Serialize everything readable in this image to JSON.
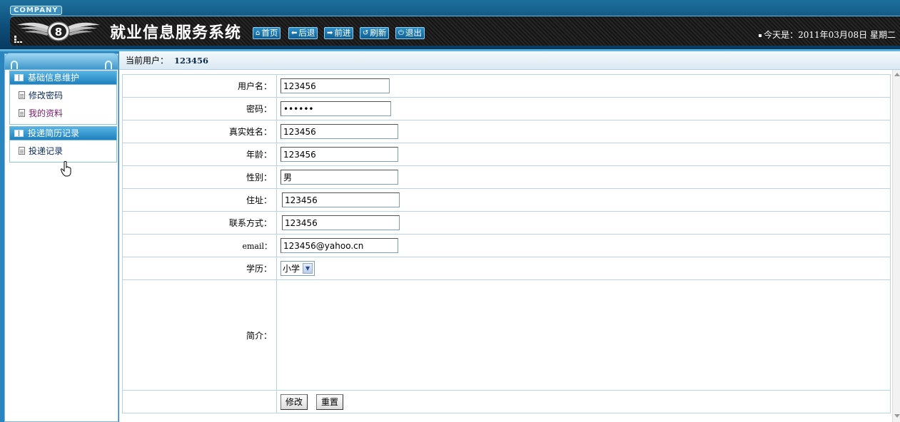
{
  "header": {
    "company_badge": "COMPANY",
    "logo": "winged-b-logo",
    "title": "就业信息服务系统",
    "nav": [
      {
        "icon": "home-icon",
        "glyph": "⌂",
        "label": "首页"
      },
      {
        "icon": "arrow-left-icon",
        "glyph": "⬅",
        "label": "后退"
      },
      {
        "icon": "arrow-right-icon",
        "glyph": "➡",
        "label": "前进"
      },
      {
        "icon": "refresh-icon",
        "glyph": "↺",
        "label": "刷新"
      },
      {
        "icon": "power-icon",
        "glyph": "⏻",
        "label": "退出"
      }
    ],
    "date_text": "今天是：2011年03月08日  星期二"
  },
  "sidebar": {
    "groups": [
      {
        "title": "基础信息维护",
        "items": [
          "修改密码",
          "我的资料"
        ]
      },
      {
        "title": "投递简历记录",
        "items": [
          "投递记录"
        ]
      }
    ]
  },
  "breadcrumb": {
    "label": "当前用户：",
    "user": "123456"
  },
  "form": {
    "username": {
      "label": "用户名：",
      "value": "123456"
    },
    "password": {
      "label": "密码：",
      "value": "123456"
    },
    "realname": {
      "label": "真实姓名：",
      "value": "123456"
    },
    "age": {
      "label": "年龄：",
      "value": "123456"
    },
    "gender": {
      "label": "性别：",
      "value": "男"
    },
    "address": {
      "label": "住址：",
      "value": "123456"
    },
    "contact": {
      "label": "联系方式：",
      "value": "123456"
    },
    "email": {
      "label": "email：",
      "value": "123456@yahoo.cn"
    },
    "education": {
      "label": "学历：",
      "value": "小学"
    },
    "intro": {
      "label": "简介：",
      "value": ""
    },
    "submit_label": "修改",
    "reset_label": "重置"
  },
  "colors": {
    "header_bg": "#0d4d78",
    "accent": "#2a84be",
    "border": "#b8d3e6"
  }
}
